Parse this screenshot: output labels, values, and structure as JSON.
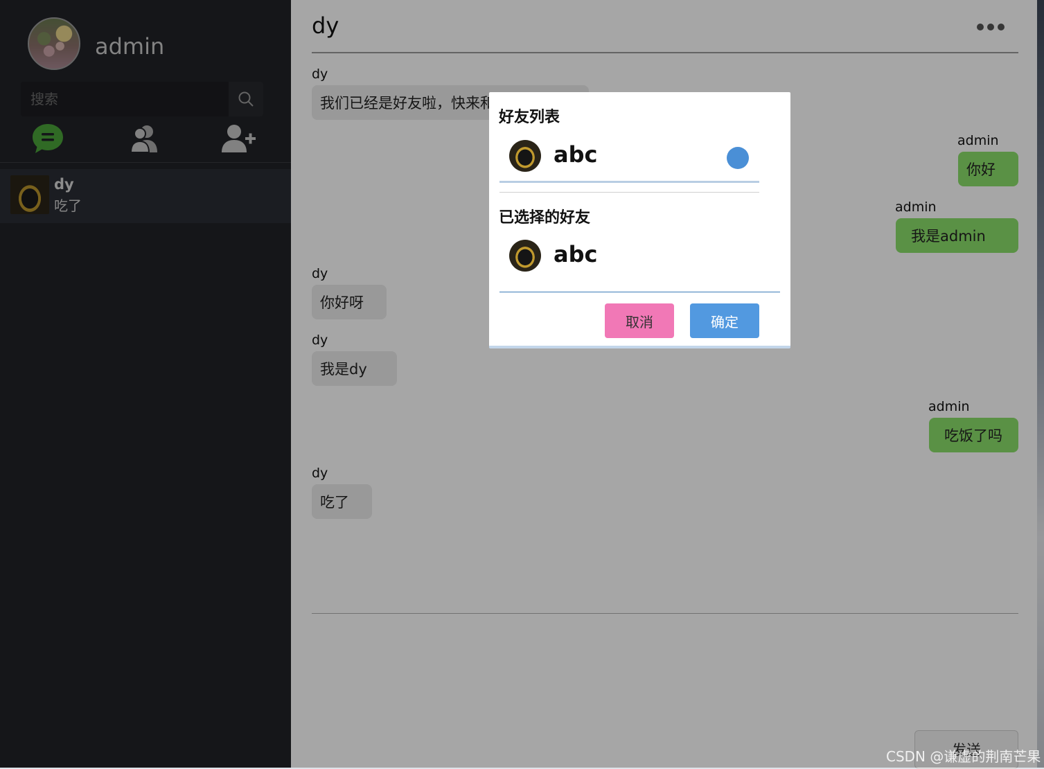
{
  "user": {
    "name": "admin"
  },
  "search": {
    "placeholder": "搜索"
  },
  "nav": {
    "chat_icon": "chat-bubble-icon",
    "contacts_icon": "contacts-icon",
    "add_friend_icon": "add-user-icon"
  },
  "conversations": [
    {
      "name": "dy",
      "last_message": "吃了"
    }
  ],
  "chat": {
    "title": "dy",
    "messages": [
      {
        "sender": "dy",
        "text": "我们已经是好友啦，快来和",
        "direction": "in"
      },
      {
        "sender": "admin",
        "text": "你好",
        "direction": "out"
      },
      {
        "sender": "admin",
        "text": "我是admin",
        "direction": "out"
      },
      {
        "sender": "dy",
        "text": "你好呀",
        "direction": "in"
      },
      {
        "sender": "dy",
        "text": "我是dy",
        "direction": "in"
      },
      {
        "sender": "admin",
        "text": "吃饭了吗",
        "direction": "out"
      },
      {
        "sender": "dy",
        "text": "吃了",
        "direction": "in"
      }
    ],
    "send_label": "发送"
  },
  "dialog": {
    "friend_list_title": "好友列表",
    "friends": [
      {
        "name": "abc",
        "selected": true
      }
    ],
    "selected_title": "已选择的好友",
    "selected": [
      {
        "name": "abc"
      }
    ],
    "cancel_label": "取消",
    "confirm_label": "确定"
  },
  "watermark": "CSDN @谦虚的荆南芒果",
  "colors": {
    "sidebar_bg": "#212227",
    "accent_green": "#4aa43a",
    "bubble_out": "#8bdf6a",
    "bubble_in": "#ebebeb",
    "cancel_pink": "#f178b6",
    "confirm_blue": "#5299e0"
  }
}
